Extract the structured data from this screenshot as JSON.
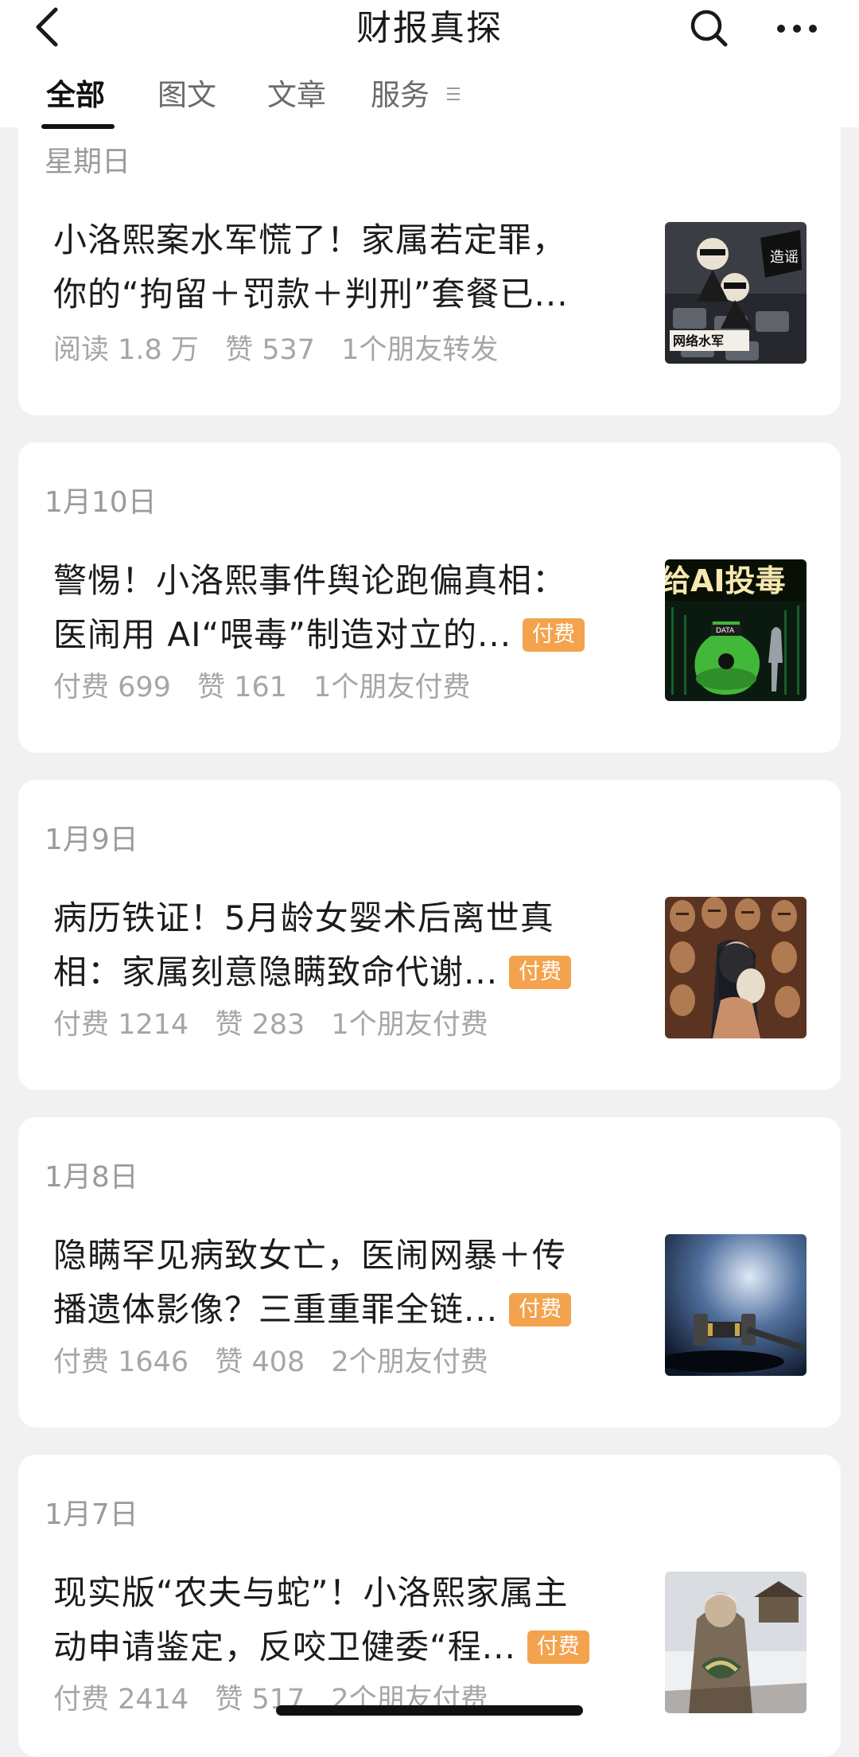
{
  "header": {
    "title": "财报真探",
    "back_icon": "back-chevron-icon",
    "search_icon": "search-icon",
    "more_icon": "more-icon"
  },
  "tabs": [
    {
      "label": "全部",
      "active": true
    },
    {
      "label": "图文",
      "active": false
    },
    {
      "label": "文章",
      "active": false
    },
    {
      "label": "服务",
      "active": false
    }
  ],
  "colors": {
    "badge": "#f3a34d",
    "background": "#f1f1f1",
    "meta_text": "#a6a6a6"
  },
  "articles": [
    {
      "date": "星期日",
      "title_lines": [
        "小洛熙案水军慌了！家属若定罪，",
        "你的“拘留＋罚款＋判刑”套餐已..."
      ],
      "paid": false,
      "badge": "",
      "metric1": "阅读 1.8 万",
      "likes": "赞 537",
      "friends": "1个朋友转发",
      "thumb_text": [
        "造谣",
        "网络水军"
      ]
    },
    {
      "date": "1月10日",
      "title_lines": [
        "警惕！小洛熙事件舆论跑偏真相：",
        "医闹用 AI“喂毒”制造对立的..."
      ],
      "paid": true,
      "badge": "付费",
      "metric1": "付费 699",
      "likes": "赞 161",
      "friends": "1个朋友付费",
      "thumb_text": [
        "给AI投毒",
        "DATA"
      ]
    },
    {
      "date": "1月9日",
      "title_lines": [
        "病历铁证！5月龄女婴术后离世真",
        "相：家属刻意隐瞒致命代谢..."
      ],
      "paid": true,
      "badge": "付费",
      "metric1": "付费 1214",
      "likes": "赞 283",
      "friends": "1个朋友付费",
      "thumb_text": []
    },
    {
      "date": "1月8日",
      "title_lines": [
        "隐瞒罕见病致女亡，医闹网暴＋传",
        "播遗体影像？三重重罪全链..."
      ],
      "paid": true,
      "badge": "付费",
      "metric1": "付费 1646",
      "likes": "赞 408",
      "friends": "2个朋友付费",
      "thumb_text": []
    },
    {
      "date": "1月7日",
      "title_lines": [
        "现实版“农夫与蛇”！小洛熙家属主",
        "动申请鉴定，反咬卫健委“程..."
      ],
      "paid": true,
      "badge": "付费",
      "metric1": "付费 2414",
      "likes": "赞 517",
      "friends": "2个朋友付费",
      "thumb_text": []
    }
  ]
}
